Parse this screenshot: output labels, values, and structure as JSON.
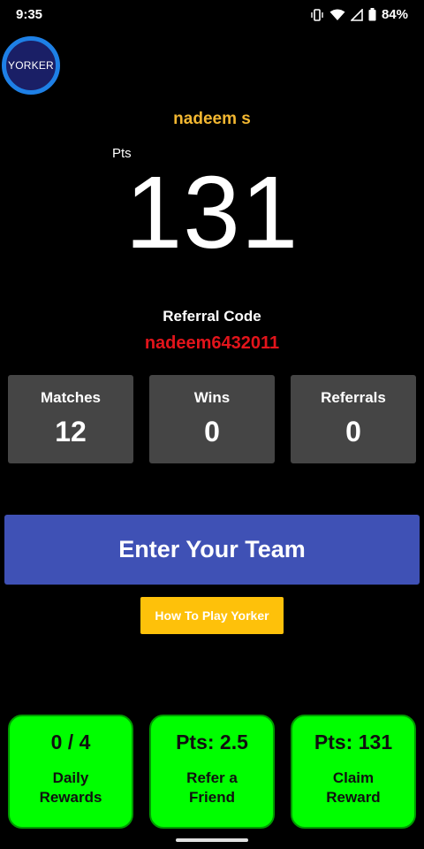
{
  "status_bar": {
    "time": "9:35",
    "battery": "84%",
    "icons": [
      "vibrate-icon",
      "wifi-icon",
      "signal-icon",
      "battery-icon"
    ]
  },
  "logo": {
    "text": "YORKER"
  },
  "user": {
    "name": "nadeem s"
  },
  "points": {
    "label": "Pts",
    "value": "131"
  },
  "referral": {
    "label": "Referral Code",
    "code": "nadeem6432011"
  },
  "stats": [
    {
      "label": "Matches",
      "value": "12"
    },
    {
      "label": "Wins",
      "value": "0"
    },
    {
      "label": "Referrals",
      "value": "0"
    }
  ],
  "buttons": {
    "enter_team": "Enter Your Team",
    "how_to_play": "How To Play Yorker"
  },
  "rewards": [
    {
      "top": "0 / 4",
      "bottom": "Daily\nRewards"
    },
    {
      "top": "Pts: 2.5",
      "bottom": "Refer a\nFriend"
    },
    {
      "top": "Pts: 131",
      "bottom": "Claim\nReward"
    }
  ],
  "colors": {
    "background": "#000000",
    "name": "#f3b731",
    "referral_code": "#e2141b",
    "stat_card": "#454545",
    "primary_button": "#3f51b5",
    "secondary_button": "#fec10a",
    "reward_card": "#00ff00",
    "logo_ring": "#1e80e6",
    "logo_fill": "#1a1f66"
  }
}
